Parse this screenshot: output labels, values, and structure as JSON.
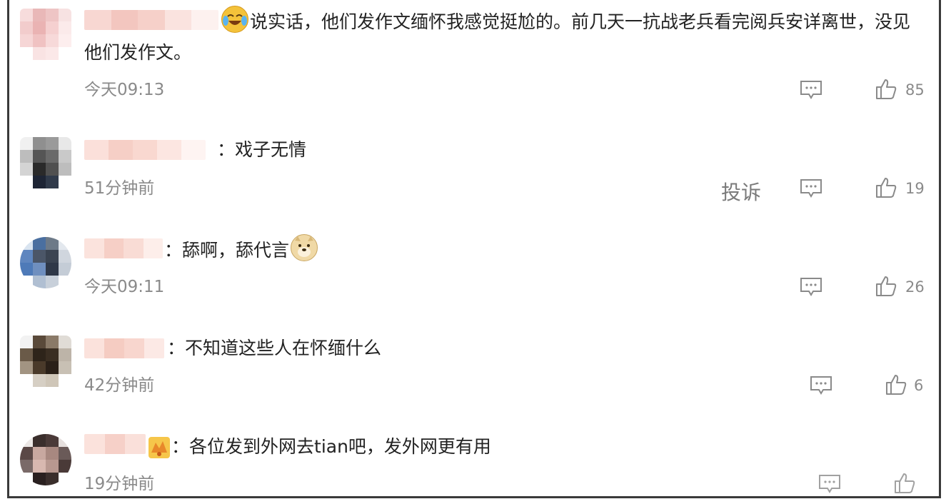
{
  "comments": [
    {
      "text_prefix": "",
      "text": "说实话，他们发作文缅怀我感觉挺尬的。前几天一抗战老兵看完阅兵安详离世，没见",
      "text_line2": "他们发作文。",
      "time": "今天09:13",
      "likes": "85",
      "emoji": "laugh-cry-emoji"
    },
    {
      "separator": "：",
      "text": "戏子无情",
      "time": "51分钟前",
      "likes": "19",
      "report_label": "投诉"
    },
    {
      "separator": "：",
      "text": "舔啊，舔代言",
      "time": "今天09:11",
      "likes": "26",
      "emoji": "doge-emoji"
    },
    {
      "separator": "：",
      "text": "不知道这些人在怀缅什么",
      "time": "42分钟前",
      "likes": "6"
    },
    {
      "separator": "：",
      "text": "各位发到外网去tian吧，发外网更有用",
      "time": "19分钟前",
      "likes": ""
    }
  ],
  "colors": {
    "text": "#222222",
    "meta": "#8a8a8a",
    "icon": "#8a8a8a"
  }
}
